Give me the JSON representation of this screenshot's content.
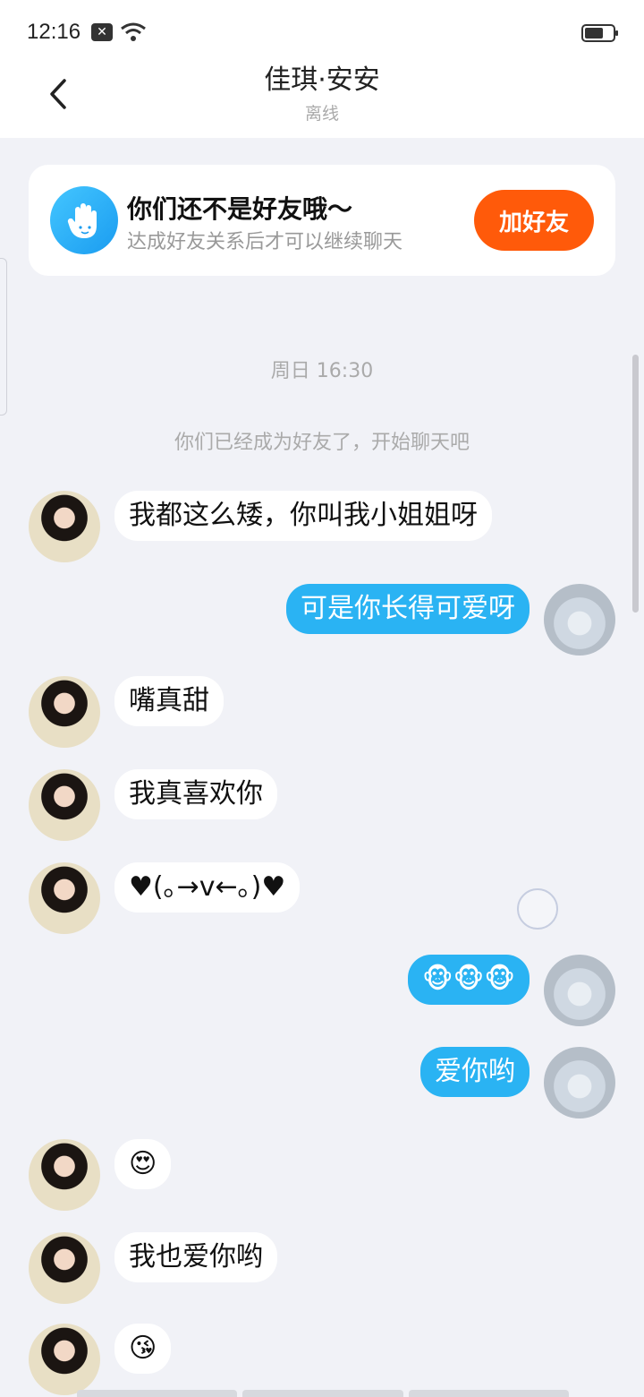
{
  "status_bar": {
    "time": "12:16"
  },
  "header": {
    "title": "佳琪·安安",
    "subtitle": "离线"
  },
  "friend_card": {
    "title": "你们还不是好友哦～",
    "subtitle": "达成好友关系后才可以继续聊天",
    "button_label": "加好友"
  },
  "system": {
    "timestamp": "周日 16:30",
    "note": "你们已经成为好友了，开始聊天吧"
  },
  "messages": [
    {
      "side": "left",
      "text": "我都这么矮，你叫我小姐姐呀"
    },
    {
      "side": "right",
      "text": "可是你长得可爱呀"
    },
    {
      "side": "left",
      "text": "嘴真甜"
    },
    {
      "side": "left",
      "text": "我真喜欢你"
    },
    {
      "side": "left",
      "text": "♥(｡→v←｡)♥"
    },
    {
      "side": "right",
      "text": "🐵🐵🐵",
      "icon": "monkey-sticker-icon"
    },
    {
      "side": "right",
      "text": "爱你哟"
    },
    {
      "side": "left",
      "text": "😍",
      "icon": "heart-eyes-emoji-icon"
    },
    {
      "side": "left",
      "text": "我也爱你哟"
    },
    {
      "side": "left",
      "text": "😘",
      "icon": "kiss-emoji-icon"
    }
  ],
  "colors": {
    "accent_blue": "#2ab3f3",
    "add_button": "#ff5a0a",
    "background": "#f1f2f7"
  }
}
